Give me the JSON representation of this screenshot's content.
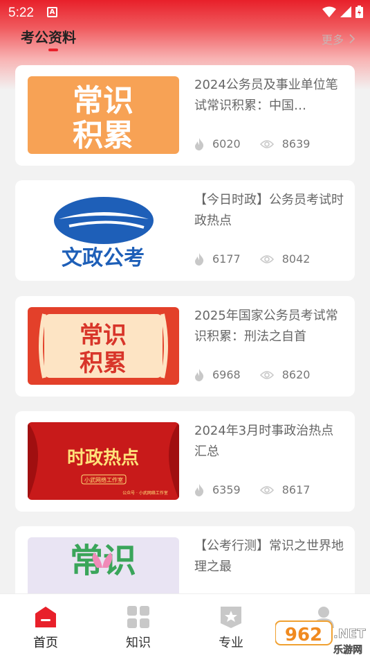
{
  "status_bar": {
    "time": "5:22",
    "notification_letter": "A"
  },
  "header": {
    "title": "考公资料",
    "more_label": "更多"
  },
  "articles": [
    {
      "title": "2024公务员及事业单位笔试常识积累：中国…",
      "likes": "6020",
      "views": "8639",
      "thumb_text": [
        "常识",
        "积累"
      ]
    },
    {
      "title": "【今日时政】公务员考试时政热点",
      "likes": "6177",
      "views": "8042",
      "thumb_text": [
        "文政公考"
      ]
    },
    {
      "title": "2025年国家公务员考试常识积累：刑法之自首",
      "likes": "6968",
      "views": "8620",
      "thumb_text": [
        "常识",
        "积累"
      ]
    },
    {
      "title": "2024年3月时事政治热点汇总",
      "likes": "6359",
      "views": "8617",
      "thumb_text": [
        "时政热点",
        "小武网络工作室",
        "公众号 · 小武网络工作室"
      ]
    },
    {
      "title": "【公考行测】常识之世界地理之最",
      "likes": "",
      "views": "",
      "thumb_text": [
        "常识"
      ]
    }
  ],
  "tabs": [
    {
      "label": "首页",
      "icon": "home-icon",
      "active": true
    },
    {
      "label": "知识",
      "icon": "grid-icon",
      "active": false
    },
    {
      "label": "专业",
      "icon": "badge-star-icon",
      "active": false
    },
    {
      "label": "",
      "icon": "profile-icon",
      "active": false
    }
  ],
  "watermark": {
    "text": "962",
    "suffix": ".NET",
    "sub": "乐游网"
  },
  "colors": {
    "accent": "#e8202a",
    "orange_thumb": "#f7a255",
    "red_thumb": "#e3402a",
    "blue_logo": "#1e5fb8"
  }
}
